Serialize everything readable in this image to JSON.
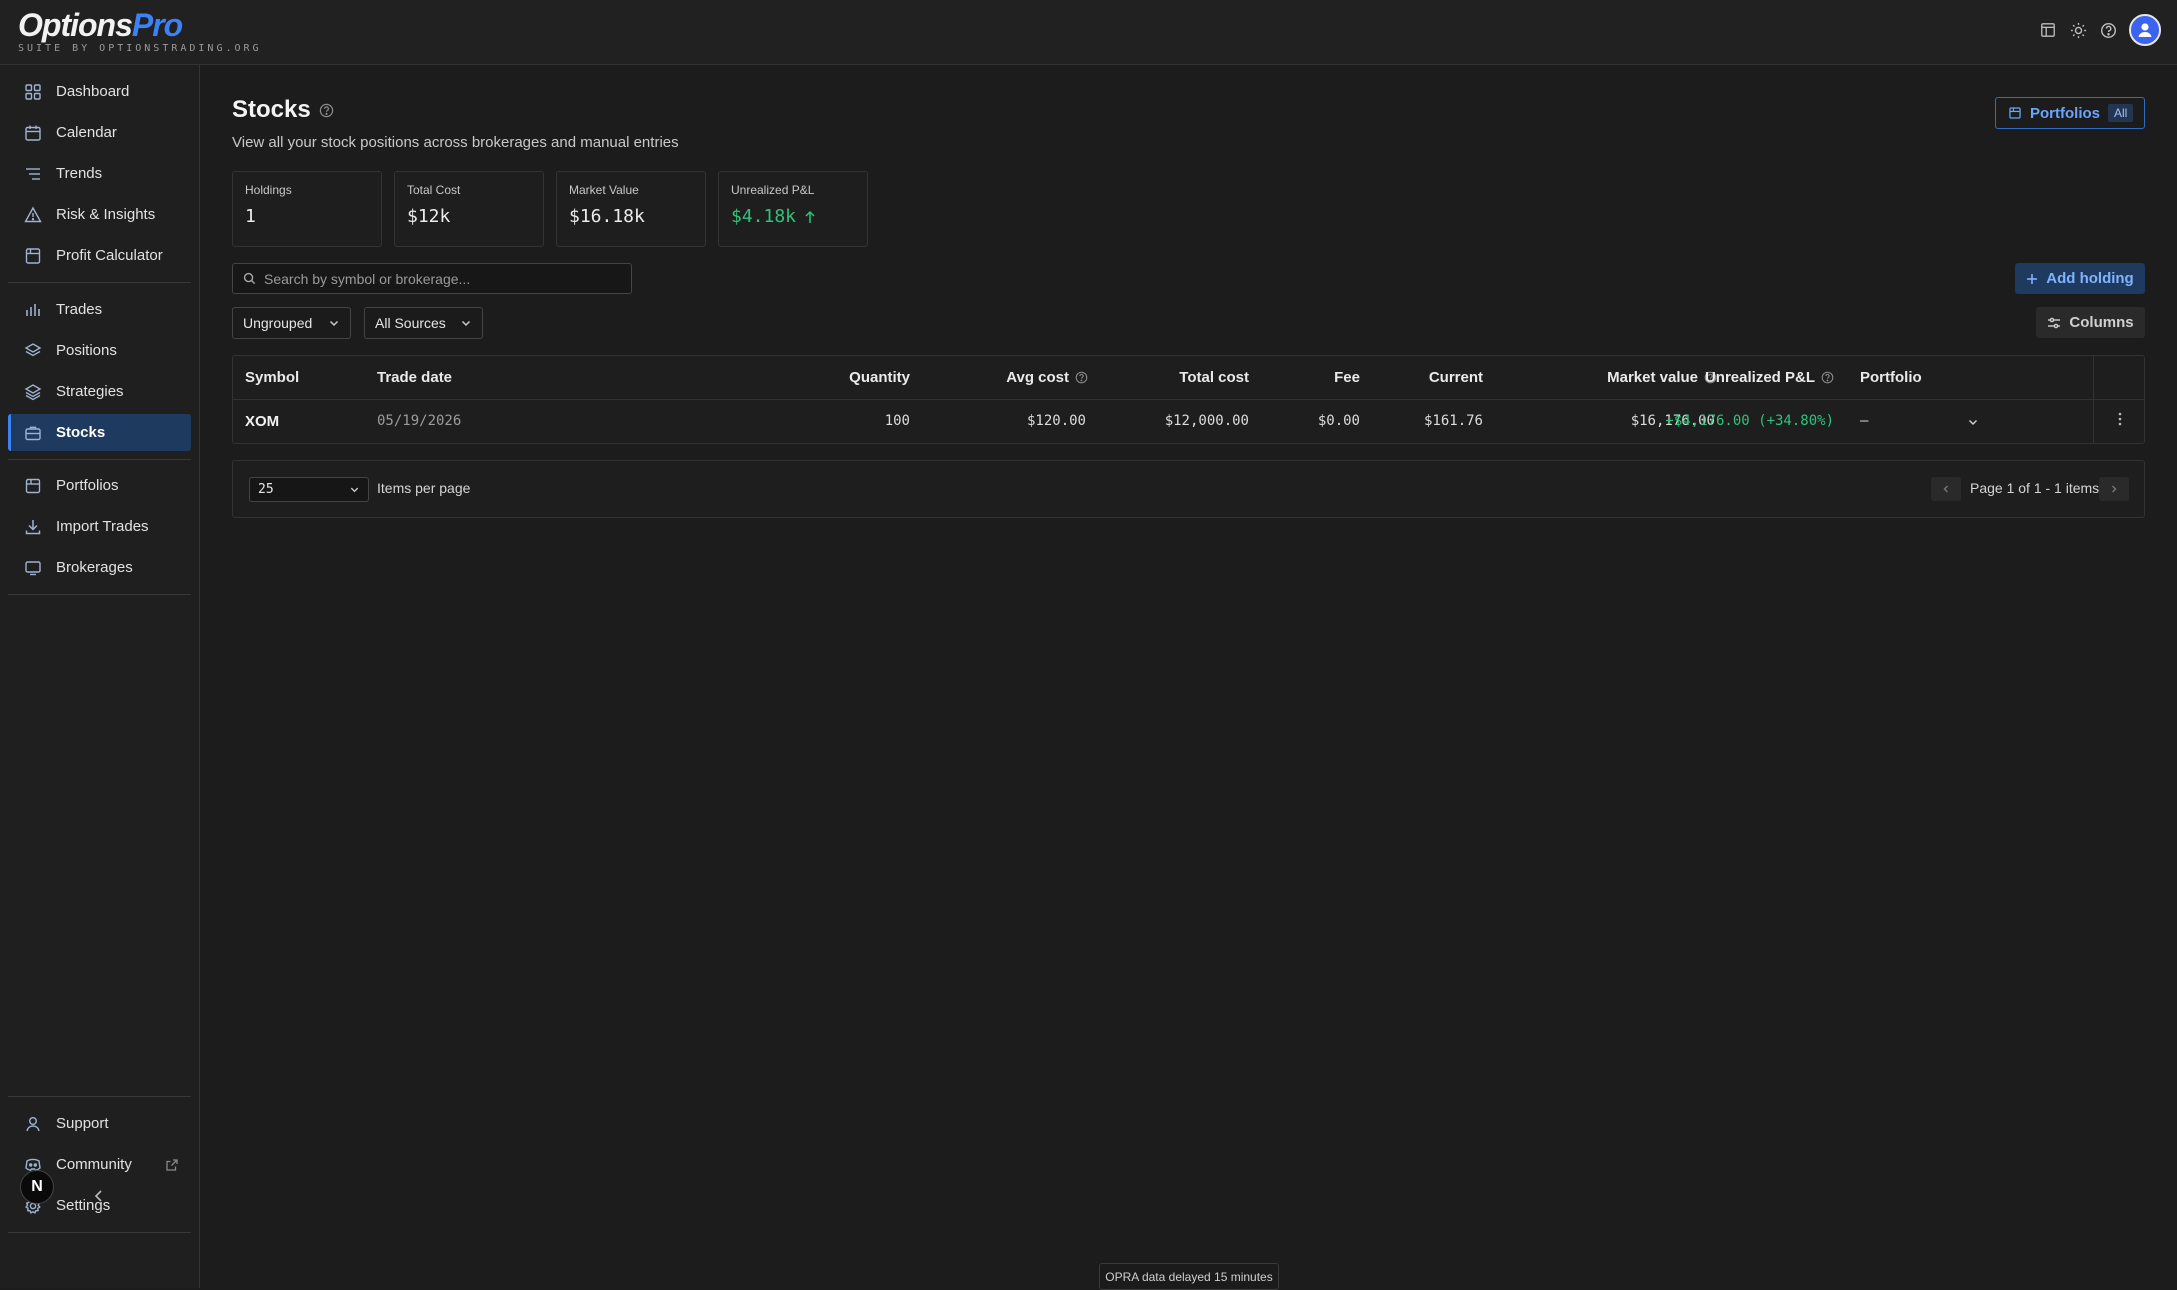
{
  "brand": {
    "name_main": "Options",
    "name_accent": "Pro",
    "tagline": "SUITE BY OPTIONSTRADING.ORG"
  },
  "sidebar": {
    "group1": [
      {
        "label": "Dashboard",
        "icon": "grid-icon"
      },
      {
        "label": "Calendar",
        "icon": "calendar-icon"
      },
      {
        "label": "Trends",
        "icon": "list-icon"
      },
      {
        "label": "Risk & Insights",
        "icon": "warning-icon"
      },
      {
        "label": "Profit Calculator",
        "icon": "calculator-icon"
      }
    ],
    "group2": [
      {
        "label": "Trades",
        "icon": "bar-chart-icon"
      },
      {
        "label": "Positions",
        "icon": "layers-icon"
      },
      {
        "label": "Strategies",
        "icon": "layers-icon"
      },
      {
        "label": "Stocks",
        "icon": "briefcase-icon",
        "active": true
      }
    ],
    "group3": [
      {
        "label": "Portfolios",
        "icon": "folder-icon"
      },
      {
        "label": "Import Trades",
        "icon": "download-icon"
      },
      {
        "label": "Brokerages",
        "icon": "monitor-icon"
      }
    ],
    "bottom": [
      {
        "label": "Support",
        "icon": "user-icon"
      },
      {
        "label": "Community",
        "icon": "discord-icon"
      },
      {
        "label": "Settings",
        "icon": "gear-icon"
      }
    ],
    "badge": "N"
  },
  "page": {
    "title": "Stocks",
    "subtitle": "View all your stock positions across brokerages and manual entries",
    "portfolios_label": "Portfolios",
    "portfolios_filter": "All"
  },
  "stats": [
    {
      "label": "Holdings",
      "value": "1"
    },
    {
      "label": "Total Cost",
      "value": "$12k"
    },
    {
      "label": "Market Value",
      "value": "$16.18k"
    },
    {
      "label": "Unrealized P&L",
      "value": "$4.18k",
      "trend": "up"
    }
  ],
  "toolbar": {
    "search_placeholder": "Search by symbol or brokerage...",
    "add_label": "Add holding",
    "group_value": "Ungrouped",
    "source_value": "All Sources",
    "columns_label": "Columns"
  },
  "table": {
    "headers": {
      "symbol": "Symbol",
      "trade_date": "Trade date",
      "quantity": "Quantity",
      "avg_cost": "Avg cost",
      "total_cost": "Total cost",
      "fee": "Fee",
      "current": "Current",
      "market_value": "Market value",
      "unrealized": "Unrealized P&L",
      "portfolio": "Portfolio"
    },
    "rows": [
      {
        "symbol": "XOM",
        "trade_date": "05/19/2026",
        "quantity": "100",
        "avg_cost": "$120.00",
        "total_cost": "$12,000.00",
        "fee": "$0.00",
        "current": "$161.76",
        "market_value": "$16,176.00",
        "unrealized": "+$4,176.00 (+34.80%)",
        "portfolio": "—"
      }
    ]
  },
  "pagination": {
    "per_page": "25",
    "per_page_label": "Items per page",
    "info": "Page 1 of 1 - 1 items"
  },
  "footer": {
    "delay_note": "OPRA data delayed 15 minutes"
  },
  "colors": {
    "accent": "#3b82f6",
    "positive": "#2fc27a",
    "active_bg": "#1e3a5f"
  }
}
